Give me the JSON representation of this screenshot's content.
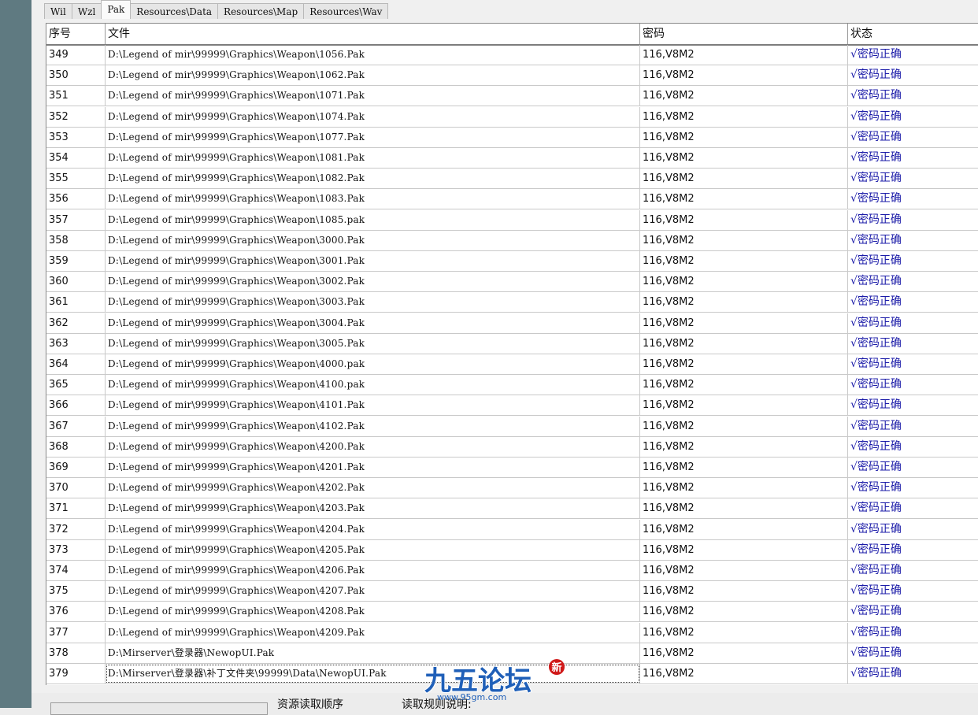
{
  "tabs": [
    "Wil",
    "Wzl",
    "Pak",
    "Resources\\Data",
    "Resources\\Map",
    "Resources\\Wav"
  ],
  "active_tab_index": 2,
  "table": {
    "headers": [
      "序号",
      "文件",
      "密码",
      "状态"
    ],
    "rows": [
      [
        "349",
        "D:\\Legend of mir\\99999\\Graphics\\Weapon\\1056.Pak",
        "116,V8M2",
        "√密码正确"
      ],
      [
        "350",
        "D:\\Legend of mir\\99999\\Graphics\\Weapon\\1062.Pak",
        "116,V8M2",
        "√密码正确"
      ],
      [
        "351",
        "D:\\Legend of mir\\99999\\Graphics\\Weapon\\1071.Pak",
        "116,V8M2",
        "√密码正确"
      ],
      [
        "352",
        "D:\\Legend of mir\\99999\\Graphics\\Weapon\\1074.Pak",
        "116,V8M2",
        "√密码正确"
      ],
      [
        "353",
        "D:\\Legend of mir\\99999\\Graphics\\Weapon\\1077.Pak",
        "116,V8M2",
        "√密码正确"
      ],
      [
        "354",
        "D:\\Legend of mir\\99999\\Graphics\\Weapon\\1081.Pak",
        "116,V8M2",
        "√密码正确"
      ],
      [
        "355",
        "D:\\Legend of mir\\99999\\Graphics\\Weapon\\1082.Pak",
        "116,V8M2",
        "√密码正确"
      ],
      [
        "356",
        "D:\\Legend of mir\\99999\\Graphics\\Weapon\\1083.Pak",
        "116,V8M2",
        "√密码正确"
      ],
      [
        "357",
        "D:\\Legend of mir\\99999\\Graphics\\Weapon\\1085.pak",
        "116,V8M2",
        "√密码正确"
      ],
      [
        "358",
        "D:\\Legend of mir\\99999\\Graphics\\Weapon\\3000.Pak",
        "116,V8M2",
        "√密码正确"
      ],
      [
        "359",
        "D:\\Legend of mir\\99999\\Graphics\\Weapon\\3001.Pak",
        "116,V8M2",
        "√密码正确"
      ],
      [
        "360",
        "D:\\Legend of mir\\99999\\Graphics\\Weapon\\3002.Pak",
        "116,V8M2",
        "√密码正确"
      ],
      [
        "361",
        "D:\\Legend of mir\\99999\\Graphics\\Weapon\\3003.Pak",
        "116,V8M2",
        "√密码正确"
      ],
      [
        "362",
        "D:\\Legend of mir\\99999\\Graphics\\Weapon\\3004.Pak",
        "116,V8M2",
        "√密码正确"
      ],
      [
        "363",
        "D:\\Legend of mir\\99999\\Graphics\\Weapon\\3005.Pak",
        "116,V8M2",
        "√密码正确"
      ],
      [
        "364",
        "D:\\Legend of mir\\99999\\Graphics\\Weapon\\4000.pak",
        "116,V8M2",
        "√密码正确"
      ],
      [
        "365",
        "D:\\Legend of mir\\99999\\Graphics\\Weapon\\4100.pak",
        "116,V8M2",
        "√密码正确"
      ],
      [
        "366",
        "D:\\Legend of mir\\99999\\Graphics\\Weapon\\4101.Pak",
        "116,V8M2",
        "√密码正确"
      ],
      [
        "367",
        "D:\\Legend of mir\\99999\\Graphics\\Weapon\\4102.Pak",
        "116,V8M2",
        "√密码正确"
      ],
      [
        "368",
        "D:\\Legend of mir\\99999\\Graphics\\Weapon\\4200.Pak",
        "116,V8M2",
        "√密码正确"
      ],
      [
        "369",
        "D:\\Legend of mir\\99999\\Graphics\\Weapon\\4201.Pak",
        "116,V8M2",
        "√密码正确"
      ],
      [
        "370",
        "D:\\Legend of mir\\99999\\Graphics\\Weapon\\4202.Pak",
        "116,V8M2",
        "√密码正确"
      ],
      [
        "371",
        "D:\\Legend of mir\\99999\\Graphics\\Weapon\\4203.Pak",
        "116,V8M2",
        "√密码正确"
      ],
      [
        "372",
        "D:\\Legend of mir\\99999\\Graphics\\Weapon\\4204.Pak",
        "116,V8M2",
        "√密码正确"
      ],
      [
        "373",
        "D:\\Legend of mir\\99999\\Graphics\\Weapon\\4205.Pak",
        "116,V8M2",
        "√密码正确"
      ],
      [
        "374",
        "D:\\Legend of mir\\99999\\Graphics\\Weapon\\4206.Pak",
        "116,V8M2",
        "√密码正确"
      ],
      [
        "375",
        "D:\\Legend of mir\\99999\\Graphics\\Weapon\\4207.Pak",
        "116,V8M2",
        "√密码正确"
      ],
      [
        "376",
        "D:\\Legend of mir\\99999\\Graphics\\Weapon\\4208.Pak",
        "116,V8M2",
        "√密码正确"
      ],
      [
        "377",
        "D:\\Legend of mir\\99999\\Graphics\\Weapon\\4209.Pak",
        "116,V8M2",
        "√密码正确"
      ],
      [
        "378",
        "D:\\Mirserver\\登录器\\NewopUI.Pak",
        "116,V8M2",
        "√密码正确"
      ],
      [
        "379",
        "D:\\Mirserver\\登录器\\补丁文件夹\\99999\\Data\\NewopUI.Pak",
        "116,V8M2",
        "√密码正确"
      ]
    ]
  },
  "bottom": {
    "group_resource_order": "资源读取顺序",
    "group_read_rules": "读取规则说明:"
  },
  "watermark": {
    "text": "九五论坛",
    "badge": "新",
    "url": "www.95gm.com"
  },
  "colors": {
    "status_ok": "#1b1ba8",
    "sidebar": "#5f7a81"
  }
}
